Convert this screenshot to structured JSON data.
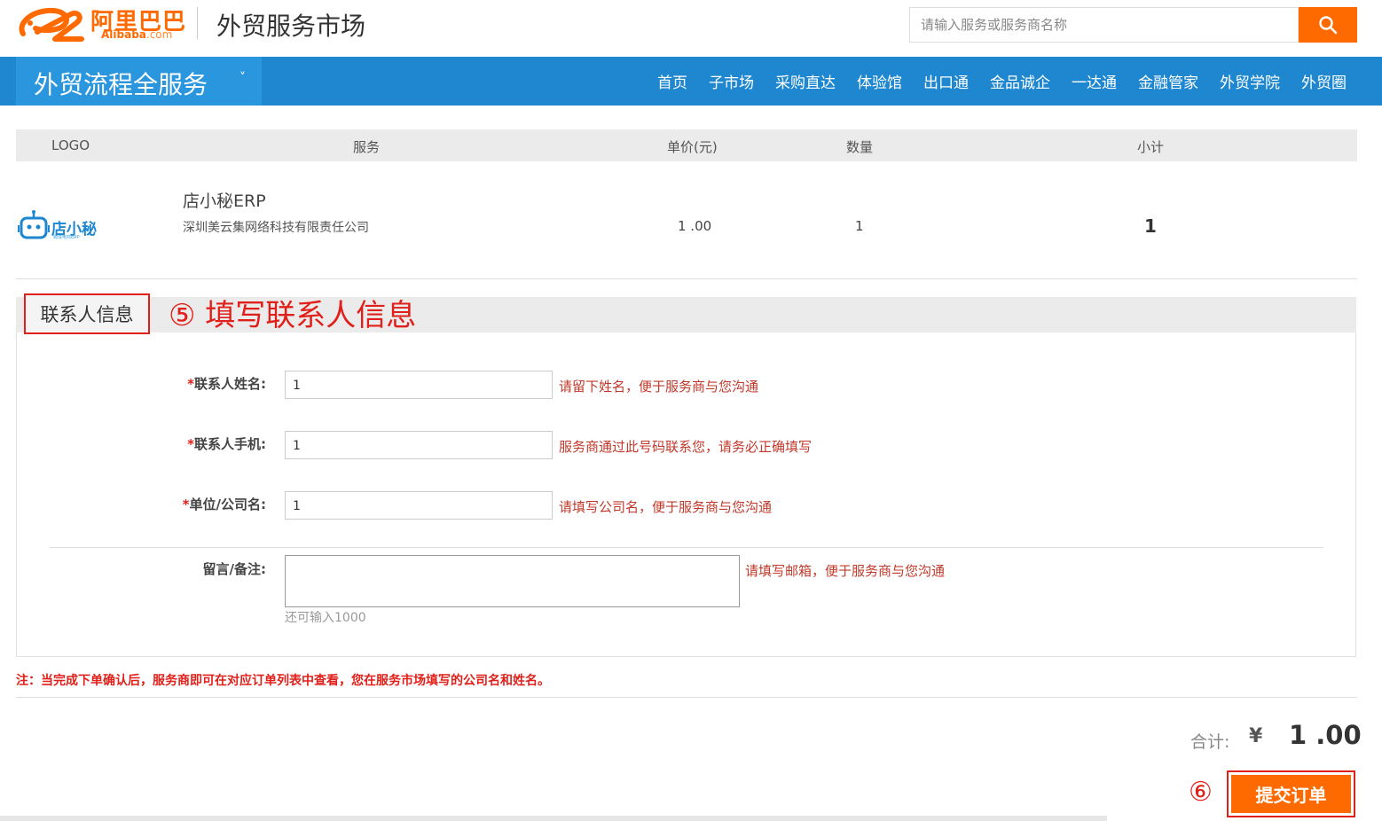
{
  "header": {
    "brand_cn": "阿里巴巴",
    "brand_en": "Alibaba",
    "brand_en_suffix": ".com",
    "market_title": "外贸服务市场",
    "search_placeholder": "请输入服务或服务商名称",
    "search_icon": "search-icon",
    "accent_color": "#ff6a00"
  },
  "nav": {
    "category_label": "外贸流程全服务",
    "category_arrow": "˅",
    "items": [
      "首页",
      "子市场",
      "采购直达",
      "体验馆",
      "出口通",
      "金品诚企",
      "一达通",
      "金融管家",
      "外贸学院",
      "外贸圈"
    ],
    "bar_color": "#1e87d0"
  },
  "order_table": {
    "headers": [
      "LOGO",
      "服务",
      "单价(元)",
      "数量",
      "小计"
    ],
    "row": {
      "logo_text": "店小秘",
      "logo_subtext": "跨境电商ERP",
      "service_name": "店小秘ERP",
      "company": "深圳美云集网络科技有限责任公司",
      "price": "1 .00",
      "quantity": "1",
      "subtotal": "1"
    }
  },
  "contact": {
    "section_tab": "联系人信息",
    "annotation": "⑤ 填写联系人信息",
    "fields": [
      {
        "required": "*",
        "label": "联系人姓名:",
        "value": "1",
        "hint": "请留下姓名，便于服务商与您沟通"
      },
      {
        "required": "*",
        "label": "联系人手机:",
        "value": "1",
        "hint": "服务商通过此号码联系您，请务必正确填写"
      },
      {
        "required": "*",
        "label": "单位/公司名:",
        "value": "1",
        "hint": "请填写公司名，便于服务商与您沟通"
      }
    ],
    "remark": {
      "label": "留言/备注:",
      "value": "",
      "hint": "请填写邮箱，便于服务商与您沟通",
      "counter": "还可输入1000"
    }
  },
  "note": "注：当完成下单确认后，服务商即可在对应订单列表中查看，您在服务市场填写的公司名和姓名。",
  "summary": {
    "total_label": "合计:",
    "currency": "¥",
    "total_amount": "1 .00",
    "annotation": "⑥",
    "submit_label": "提交订单"
  }
}
